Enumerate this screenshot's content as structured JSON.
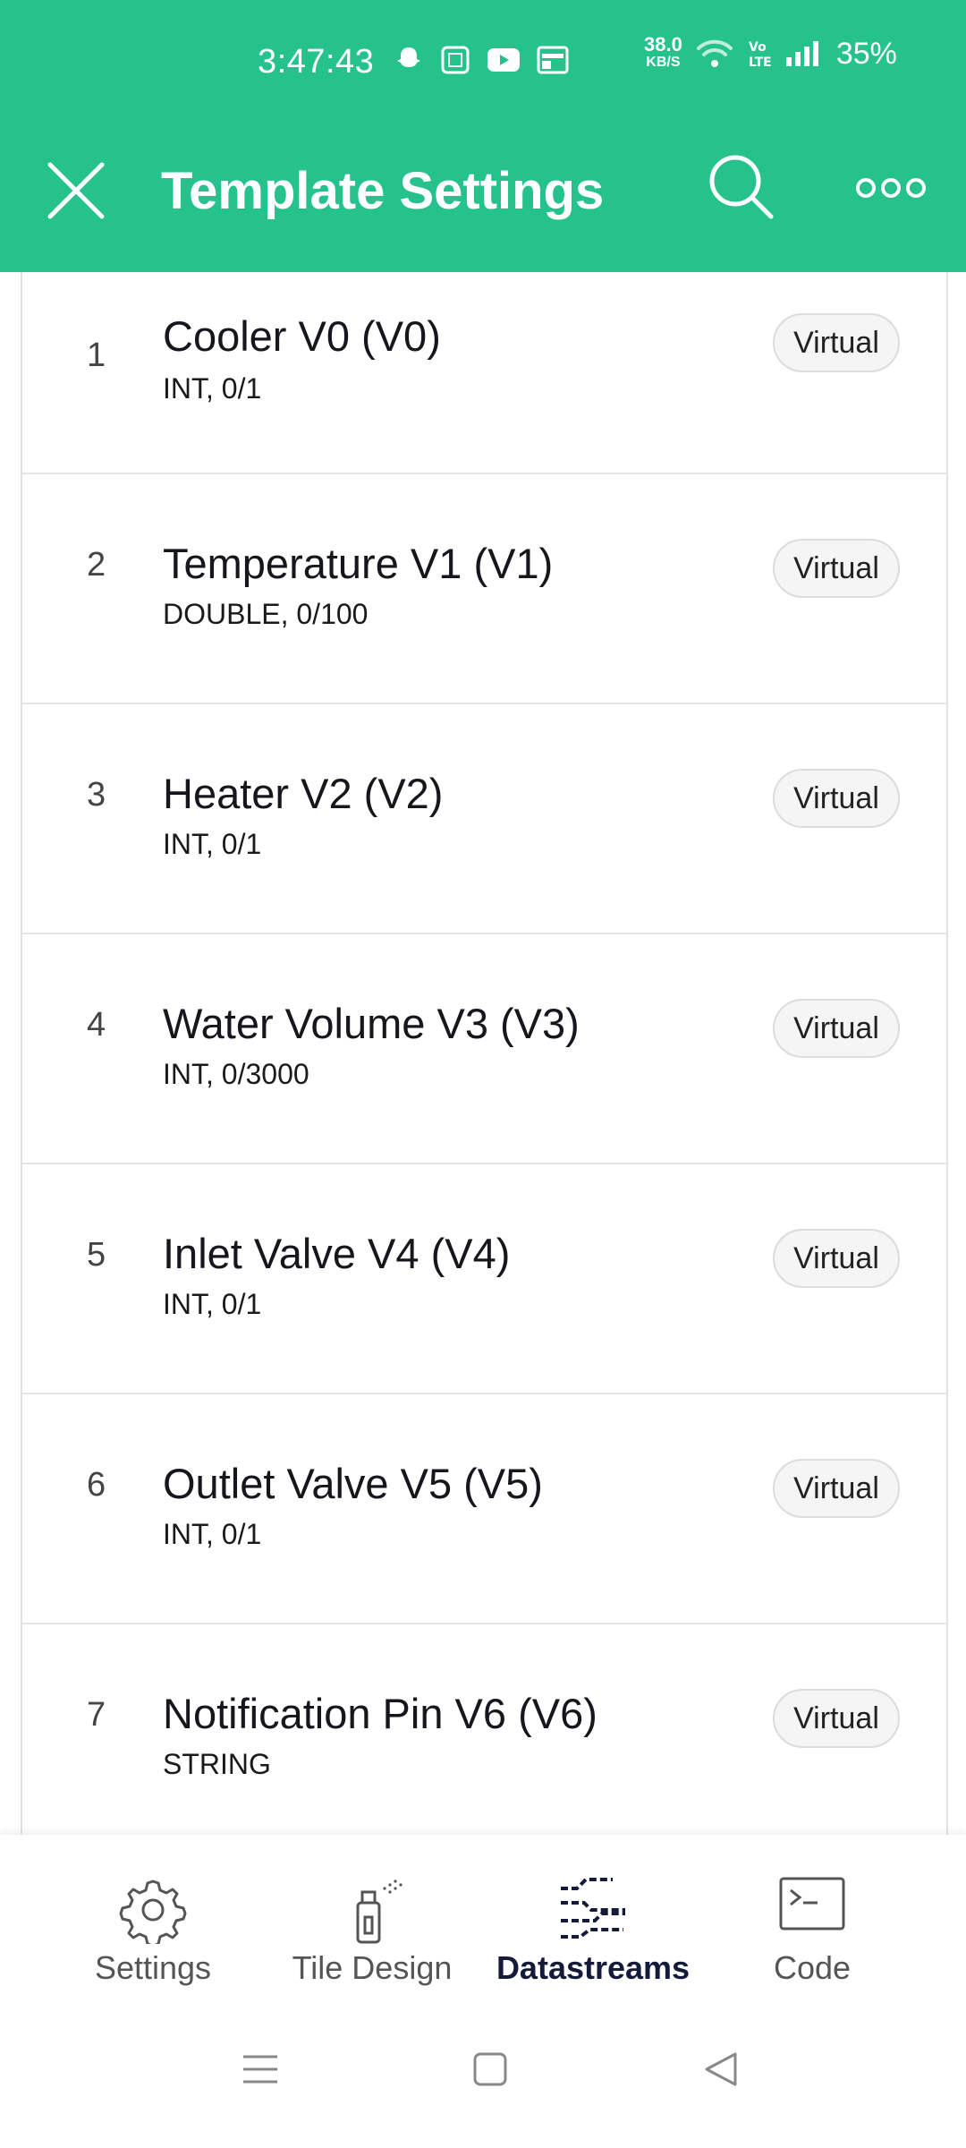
{
  "status": {
    "time": "3:47:43",
    "speed_top": "38.0",
    "speed_bottom": "KB/S",
    "battery": "35%",
    "icons": [
      "snapchat-icon",
      "sim-icon",
      "youtube-icon",
      "news-icon",
      "wifi-icon",
      "volte-icon",
      "signal-icon"
    ]
  },
  "appbar": {
    "title": "Template Settings",
    "color": "#25c38b"
  },
  "datastreams": [
    {
      "num": "1",
      "title": "Cooler V0 (V0)",
      "sub": "INT, 0/1",
      "badge": "Virtual"
    },
    {
      "num": "2",
      "title": "Temperature V1 (V1)",
      "sub": "DOUBLE, 0/100",
      "badge": "Virtual"
    },
    {
      "num": "3",
      "title": "Heater V2 (V2)",
      "sub": "INT, 0/1",
      "badge": "Virtual"
    },
    {
      "num": "4",
      "title": "Water Volume V3 (V3)",
      "sub": "INT, 0/3000",
      "badge": "Virtual"
    },
    {
      "num": "5",
      "title": "Inlet Valve V4 (V4)",
      "sub": "INT, 0/1",
      "badge": "Virtual"
    },
    {
      "num": "6",
      "title": "Outlet Valve V5 (V5)",
      "sub": "INT, 0/1",
      "badge": "Virtual"
    },
    {
      "num": "7",
      "title": "Notification Pin V6 (V6)",
      "sub": "STRING",
      "badge": "Virtual"
    }
  ],
  "bottomnav": {
    "settings": "Settings",
    "tile_design": "Tile Design",
    "datastreams": "Datastreams",
    "code": "Code"
  }
}
